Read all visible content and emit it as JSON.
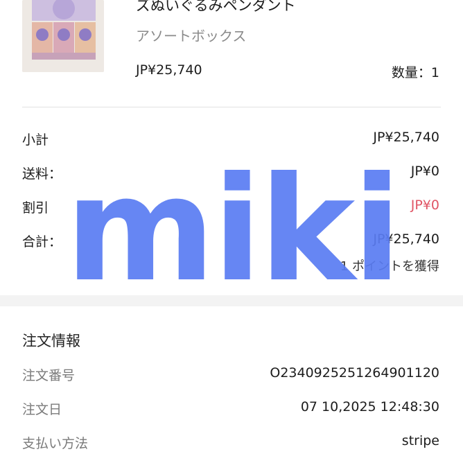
{
  "product": {
    "title": "ズぬいぐるみペンダント",
    "variant": "アソートボックス",
    "price": "JP¥25,740",
    "quantity": "数量：1"
  },
  "summary": {
    "subtotal_label": "小計",
    "subtotal_value": "JP¥25,740",
    "shipping_label": "送料：",
    "shipping_value": "JP¥0",
    "discount_label": "割引",
    "discount_value": "JP¥0",
    "total_label": "合計：",
    "total_value": "JP¥25,740",
    "points_text": "1 ポイントを獲得"
  },
  "order_info": {
    "section_title": "注文情報",
    "order_number_label": "注文番号",
    "order_number_value": "O2340925251264901120",
    "order_date_label": "注文日",
    "order_date_value": "07 10,2025 12:48:30",
    "payment_label": "支払い方法",
    "payment_value": "stripe"
  },
  "watermark": {
    "text": "miki",
    "color": "#5a7cf2"
  },
  "colors": {
    "discount": "#e05565",
    "band": "#f3f3f3",
    "divider": "#e1e1e1"
  }
}
